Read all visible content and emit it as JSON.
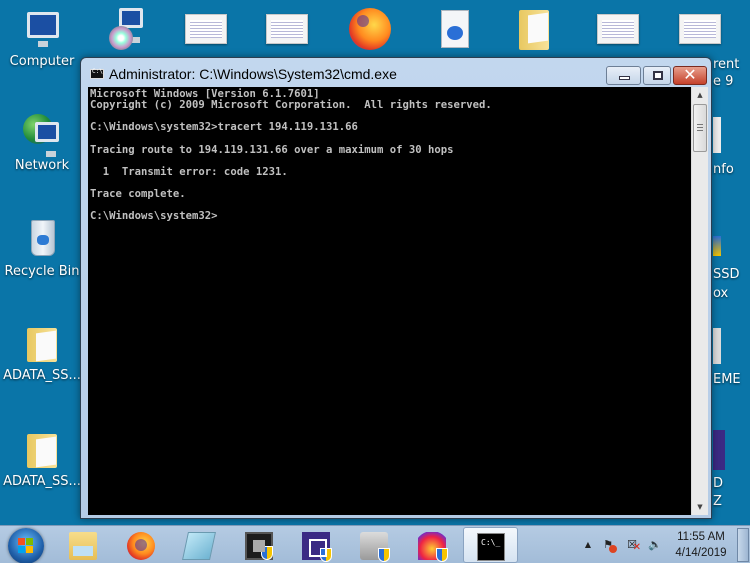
{
  "desktop": {
    "left_icons": [
      {
        "label": "Computer",
        "icon": "computer-icon"
      },
      {
        "label": "Network",
        "icon": "network-icon"
      },
      {
        "label": "Recycle Bin",
        "icon": "recycle-bin-icon"
      },
      {
        "label": "ADATA_SS...",
        "icon": "folder-icon"
      },
      {
        "label": "ADATA_SS...",
        "icon": "folder-icon"
      }
    ],
    "top_icons": [
      {
        "icon": "installer-icon"
      },
      {
        "icon": "screenshot-thumbnail-icon"
      },
      {
        "icon": "document-thumbnail-icon"
      },
      {
        "icon": "firefox-shortcut-icon"
      },
      {
        "icon": "media-file-icon"
      },
      {
        "icon": "folder-icon"
      },
      {
        "icon": "document-thumbnail-icon"
      },
      {
        "icon": "document-thumbnail-icon"
      }
    ],
    "right_partial_labels": [
      "rent",
      "e 9",
      "nfo",
      "SSD",
      "ox",
      "EME",
      "D",
      "Z"
    ]
  },
  "window": {
    "title": "Administrator: C:\\Windows\\System32\\cmd.exe",
    "buttons": {
      "minimize": "minimize",
      "maximize": "maximize",
      "close": "✕"
    }
  },
  "console": {
    "lines": [
      "Microsoft Windows [Version 6.1.7601]",
      "Copyright (c) 2009 Microsoft Corporation.  All rights reserved.",
      "",
      "C:\\Windows\\system32>tracert 194.119.131.66",
      "",
      "Tracing route to 194.119.131.66 over a maximum of 30 hops",
      "",
      "  1  Transmit error: code 1231.",
      "",
      "Trace complete.",
      "",
      "C:\\Windows\\system32>"
    ]
  },
  "scrollbar": {
    "up": "▲",
    "down": "▼"
  },
  "taskbar": {
    "items": [
      {
        "name": "start-button"
      },
      {
        "name": "windows-explorer"
      },
      {
        "name": "firefox"
      },
      {
        "name": "notepad"
      },
      {
        "name": "gpu-tool"
      },
      {
        "name": "cpu-z"
      },
      {
        "name": "ssd-tool"
      },
      {
        "name": "hummingbird-app"
      },
      {
        "name": "command-prompt",
        "active": true
      }
    ],
    "tray": {
      "show_hidden": "▲",
      "action_center": "⚑",
      "network": "☒",
      "volume": "🔉"
    },
    "clock": {
      "time": "11:55 AM",
      "date": "4/14/2019"
    }
  }
}
